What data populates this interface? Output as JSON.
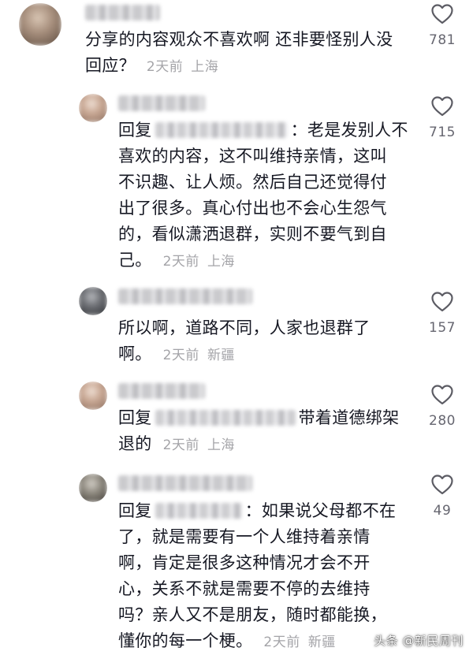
{
  "comments": [
    {
      "lines": [
        "分享的内容观众不喜欢啊 还非要怪别人没",
        "回应？"
      ],
      "time": "2天前",
      "location": "上海",
      "likes": "781",
      "avatar_colors": [
        "#a8907e",
        "#5b4a3e",
        "#d9c6b4"
      ]
    },
    {
      "reply_word": "回复",
      "after_target": "：老是发别人不",
      "lines": [
        "喜欢的内容，这不叫维持亲情，这叫",
        "不识趣、让人烦。然后自己还觉得付",
        "出了很多。真心付出也不会心生怨气",
        "的，看似潇洒退群，实则不要气到自",
        "己。"
      ],
      "time": "2天前",
      "location": "上海",
      "likes": "715",
      "avatar_colors": [
        "#c9a894",
        "#8a6d5e",
        "#efe0d5"
      ]
    },
    {
      "lines": [
        "所以啊，道路不同，人家也退群了",
        "啊。"
      ],
      "time": "2天前",
      "location": "新疆",
      "likes": "157",
      "avatar_colors": [
        "#6d6f74",
        "#2e3034",
        "#b7b9bd"
      ]
    },
    {
      "reply_word": "回复",
      "after_target": "带着道德绑架",
      "lines": [
        "退的"
      ],
      "time": "2天前",
      "location": "上海",
      "likes": "280",
      "avatar_colors": [
        "#c9a894",
        "#8a6d5e",
        "#efe0d5"
      ]
    },
    {
      "reply_word": "回复",
      "after_target": "：如果说父母都不在",
      "lines": [
        "了，就是需要有一个人维持着亲情",
        "啊，肯定是很多这种情况才会不开",
        "心，关系不就是需要不停的去维持",
        "吗？亲人又不是朋友，随时都能换，",
        "懂你的每一个梗。"
      ],
      "time": "2天前",
      "location": "新疆",
      "likes": "49",
      "avatar_colors": [
        "#8f8a80",
        "#3f3b35",
        "#d3cfc7"
      ]
    }
  ],
  "watermark": "头条 @新民周刊",
  "icons": {
    "like": "heart-outline-icon"
  }
}
